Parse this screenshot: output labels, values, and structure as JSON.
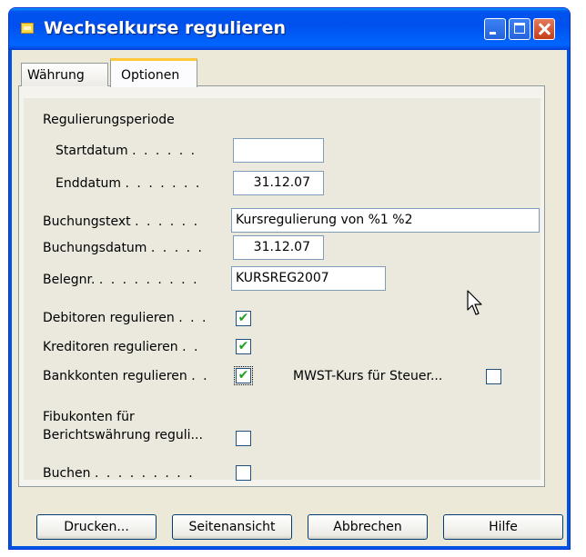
{
  "window": {
    "title": "Wechselkurse regulieren",
    "title_icon": "app-icon"
  },
  "tabs": [
    {
      "label": "Währung",
      "active": false
    },
    {
      "label": "Optionen",
      "active": true
    }
  ],
  "form": {
    "section_label": "Regulierungsperiode",
    "startdatum": {
      "label": "Startdatum",
      "dots": ". . . . . .",
      "value": ""
    },
    "enddatum": {
      "label": "Enddatum",
      "dots": ". . . . . . .",
      "value": "31.12.07"
    },
    "buchungstext": {
      "label": "Buchungstext",
      "dots": ". . . . . .",
      "value": "Kursregulierung von %1 %2"
    },
    "buchungsdatum": {
      "label": "Buchungsdatum",
      "dots": ". . . . .",
      "value": "31.12.07"
    },
    "belegnr": {
      "label": "Belegnr.",
      "dots": ". . . . . . . . .",
      "value": "KURSREG2007"
    },
    "debitoren": {
      "label": "Debitoren regulieren",
      "dots": ". . .",
      "checked": true
    },
    "kreditoren": {
      "label": "Kreditoren regulieren",
      "dots": ". .",
      "checked": true
    },
    "bankkonten": {
      "label": "Bankkonten regulieren",
      "dots": ". .",
      "checked": true
    },
    "mwst": {
      "label": "MWST-Kurs für Steuer...",
      "checked": false
    },
    "fibukonten": {
      "label_line1": "Fibukonten für",
      "label_line2": "Berichtswährung reguli...",
      "checked": false
    },
    "buchen": {
      "label": "Buchen",
      "dots": ". . . . . . . . .",
      "checked": false
    }
  },
  "buttons": {
    "drucken": "Drucken...",
    "seitenansicht": "Seitenansicht",
    "abbrechen": "Abbrechen",
    "hilfe": "Hilfe"
  },
  "checkmark_glyph": "✔"
}
